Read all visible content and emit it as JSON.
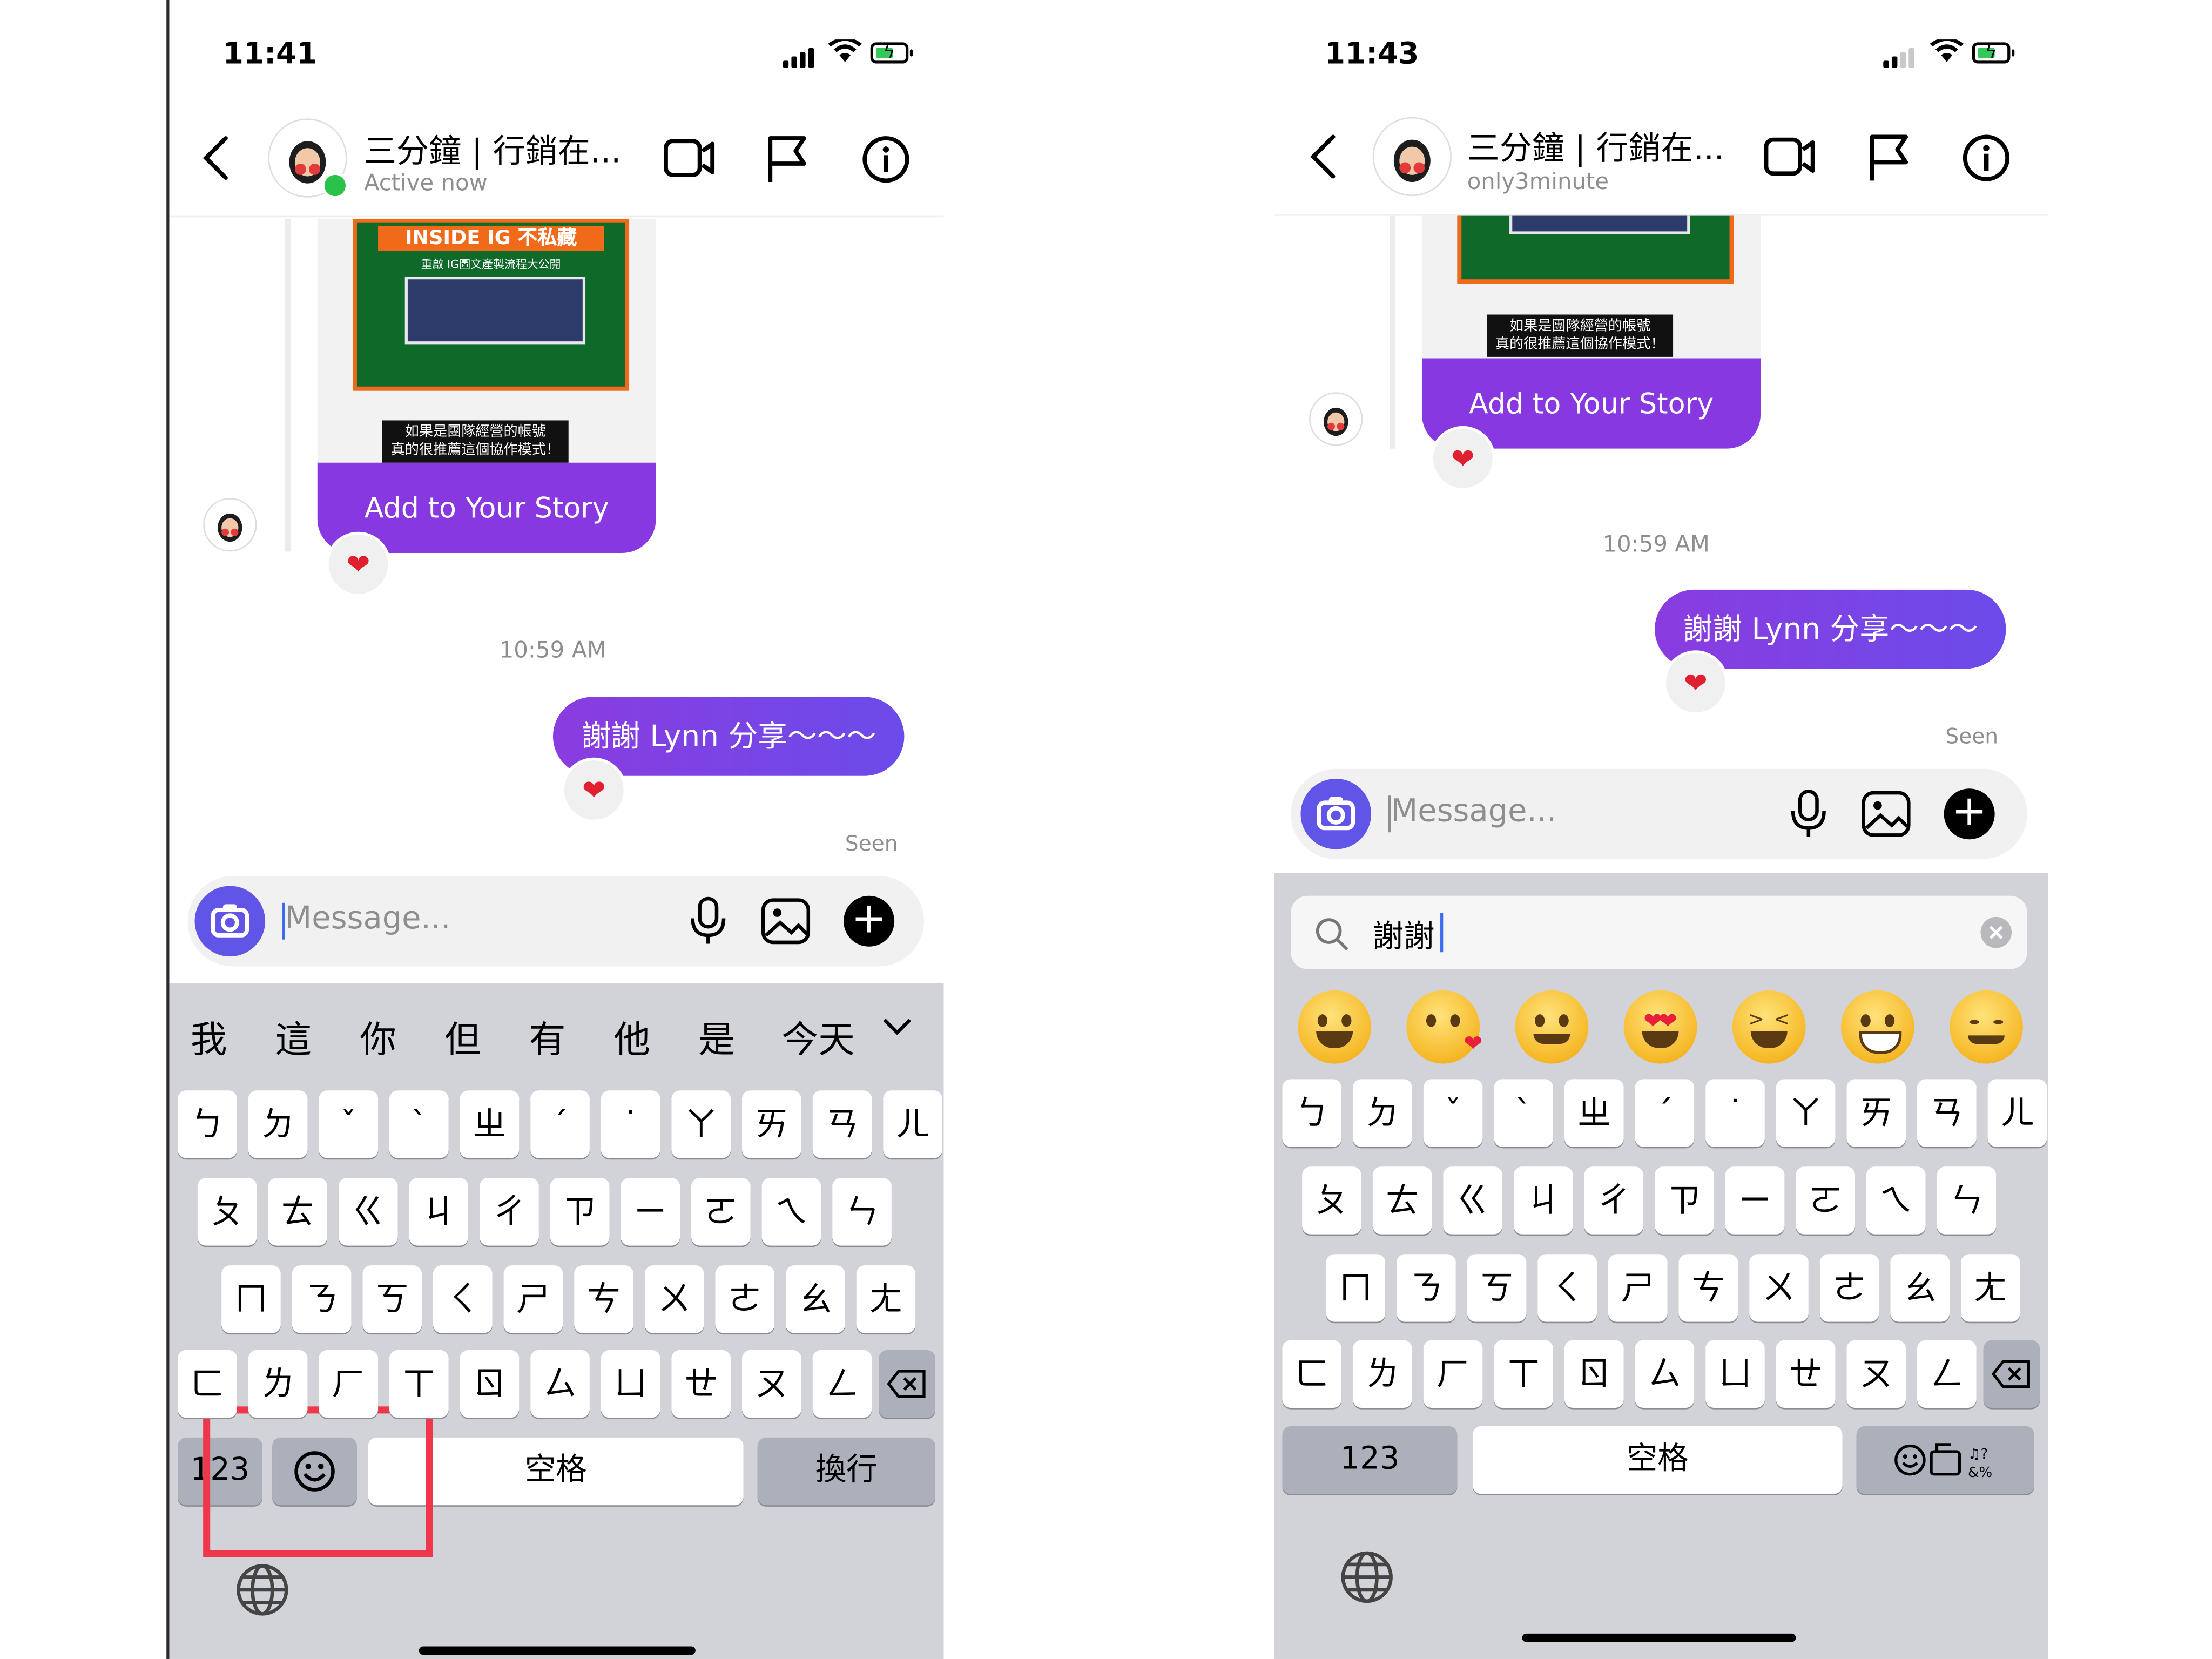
{
  "left": {
    "status": {
      "time": "11:41"
    },
    "header": {
      "name": "三分鐘 | 行銷在...",
      "subtitle": "Active now"
    },
    "shared_post": {
      "banner_text": "INSIDE IG 不私藏",
      "banner_sub": "重啟 IG圖文產製流程大公開",
      "caption_line1": "如果是團隊經營的帳號",
      "caption_line2": "真的很推薦這個協作模式！",
      "story_button": "Add to Your Story"
    },
    "reaction": "❤",
    "timestamp": "10:59 AM",
    "message": "謝謝 Lynn 分享～～～",
    "message_reaction": "❤",
    "seen": "Seen",
    "composer": {
      "placeholder": "Message..."
    },
    "keyboard": {
      "candidates": [
        "我",
        "這",
        "你",
        "但",
        "有",
        "他",
        "是",
        "今天"
      ],
      "row1": [
        "ㄅ",
        "ㄉ",
        "ˇ",
        "ˋ",
        "ㄓ",
        "ˊ",
        "˙",
        "ㄚ",
        "ㄞ",
        "ㄢ",
        "ㄦ"
      ],
      "row2": [
        "ㄆ",
        "ㄊ",
        "ㄍ",
        "ㄐ",
        "ㄔ",
        "ㄗ",
        "ㄧ",
        "ㄛ",
        "ㄟ",
        "ㄣ"
      ],
      "row3": [
        "ㄇ",
        "ㄋ",
        "ㄎ",
        "ㄑ",
        "ㄕ",
        "ㄘ",
        "ㄨ",
        "ㄜ",
        "ㄠ",
        "ㄤ"
      ],
      "row4": [
        "ㄈ",
        "ㄌ",
        "ㄏ",
        "ㄒ",
        "ㄖ",
        "ㄙ",
        "ㄩ",
        "ㄝ",
        "ㄡ",
        "ㄥ"
      ],
      "numbers_key": "123",
      "space_key": "空格",
      "return_key": "換行"
    }
  },
  "right": {
    "status": {
      "time": "11:43"
    },
    "header": {
      "name": "三分鐘 | 行銷在...",
      "subtitle": "only3minute"
    },
    "shared_post": {
      "caption_line1": "如果是團隊經營的帳號",
      "caption_line2": "真的很推薦這個協作模式！",
      "story_button": "Add to Your Story"
    },
    "reaction": "❤",
    "timestamp": "10:59 AM",
    "message": "謝謝 Lynn 分享～～～",
    "message_reaction": "❤",
    "seen": "Seen",
    "composer": {
      "placeholder": "Message..."
    },
    "emoji_search": {
      "query": "謝謝"
    },
    "keyboard": {
      "row1": [
        "ㄅ",
        "ㄉ",
        "ˇ",
        "ˋ",
        "ㄓ",
        "ˊ",
        "˙",
        "ㄚ",
        "ㄞ",
        "ㄢ",
        "ㄦ"
      ],
      "row2": [
        "ㄆ",
        "ㄊ",
        "ㄍ",
        "ㄐ",
        "ㄔ",
        "ㄗ",
        "ㄧ",
        "ㄛ",
        "ㄟ",
        "ㄣ"
      ],
      "row3": [
        "ㄇ",
        "ㄋ",
        "ㄎ",
        "ㄑ",
        "ㄕ",
        "ㄘ",
        "ㄨ",
        "ㄜ",
        "ㄠ",
        "ㄤ"
      ],
      "row4": [
        "ㄈ",
        "ㄌ",
        "ㄏ",
        "ㄒ",
        "ㄖ",
        "ㄙ",
        "ㄩ",
        "ㄝ",
        "ㄡ",
        "ㄥ"
      ],
      "numbers_key": "123",
      "space_key": "空格"
    }
  },
  "colors": {
    "accent": "#8838e0",
    "annotation_box": "#f0364a",
    "online": "#2bc24b"
  }
}
